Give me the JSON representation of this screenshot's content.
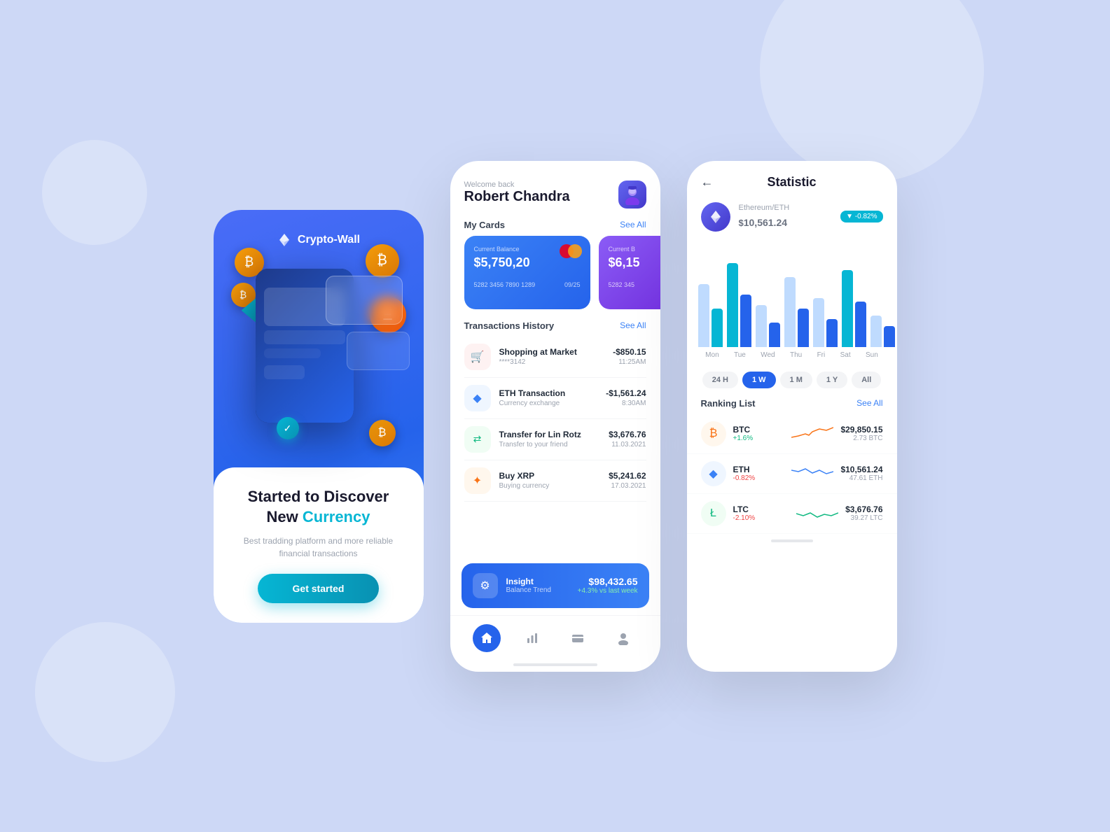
{
  "background": "#cdd8f6",
  "screen1": {
    "app_name": "Crypto-Wall",
    "headline_line1": "Started to Discover",
    "headline_line2": "New ",
    "headline_cyan": "Currency",
    "subtitle": "Best tradding platform and more reliable financial transactions",
    "cta_label": "Get started"
  },
  "screen2": {
    "welcome": "Welcome back",
    "user_name": "Robert Chandra",
    "my_cards_label": "My Cards",
    "see_all_cards": "See All",
    "cards": [
      {
        "label": "Current Balance",
        "balance": "$5,750,20",
        "number": "5282 3456 7890 1289",
        "expiry": "09/25",
        "type": "mastercard"
      },
      {
        "label": "Current B",
        "balance": "$6,15",
        "number": "5282 345",
        "type": "visa"
      }
    ],
    "transactions_label": "Transactions History",
    "see_all_tx": "See All",
    "transactions": [
      {
        "title": "Shopping at Market",
        "sub": "****3142",
        "amount": "-$850.15",
        "time": "11:25AM",
        "icon_type": "red",
        "icon": "🛒"
      },
      {
        "title": "ETH Transaction",
        "sub": "Currency exchange",
        "amount": "-$1,561.24",
        "time": "8:30AM",
        "icon_type": "blue",
        "icon": "◆"
      },
      {
        "title": "Transfer for Lin Rotz",
        "sub": "Transfer to your friend",
        "amount": "$3,676.76",
        "time": "11.03.2021",
        "icon_type": "green",
        "icon": "⇄"
      },
      {
        "title": "Buy XRP",
        "sub": "Buying currency",
        "amount": "$5,241.62",
        "time": "17.03.2021",
        "icon_type": "orange",
        "icon": "✦"
      }
    ],
    "insight_label": "Insight",
    "insight_sub": "Balance Trend",
    "insight_amount": "$98,432.65",
    "insight_change": "+4.3% vs last week",
    "nav_items": [
      "home",
      "chart",
      "card",
      "user"
    ]
  },
  "screen3": {
    "title": "Statistic",
    "coin_name": "Ethereum/ETH",
    "coin_price": "10,561.24",
    "price_change": "-0.82%",
    "chart": {
      "days": [
        "Mon",
        "Tue",
        "Wed",
        "Thu",
        "Fri",
        "Sat",
        "Sun"
      ],
      "bars": [
        [
          90,
          55
        ],
        [
          120,
          75
        ],
        [
          60,
          40
        ],
        [
          100,
          65
        ],
        [
          80,
          50
        ],
        [
          110,
          70
        ],
        [
          45,
          30
        ]
      ]
    },
    "time_filters": [
      "24 H",
      "1 W",
      "1 M",
      "1 Y",
      "All"
    ],
    "active_filter": "1 W",
    "ranking_label": "Ranking List",
    "see_all_rank": "See All",
    "rankings": [
      {
        "name": "BTC",
        "change": "+1.6%",
        "direction": "up",
        "price": "$29,850.15",
        "amount": "2.73 BTC",
        "icon": "₿",
        "color": "btc"
      },
      {
        "name": "ETH",
        "change": "-0.82%",
        "direction": "down",
        "price": "$10,561.24",
        "amount": "47.61 ETH",
        "icon": "◆",
        "color": "eth"
      },
      {
        "name": "LTC",
        "change": "-2.10%",
        "direction": "down",
        "price": "$3,676.76",
        "amount": "39.27 LTC",
        "icon": "Ł",
        "color": "ltc"
      }
    ]
  }
}
